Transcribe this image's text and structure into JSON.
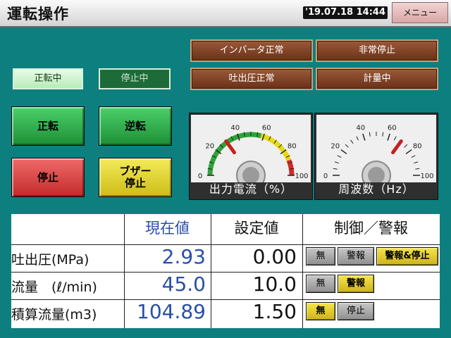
{
  "header": {
    "title": "運転操作",
    "datetime": "'19.07.18 14:44",
    "menu_label": "メニュー"
  },
  "status_lamps": {
    "inverter": "インバータ正常",
    "emergency": "非常停止",
    "discharge": "吐出圧正常",
    "metering": "計量中"
  },
  "indicators": {
    "running": "正転中",
    "stopped": "停止中"
  },
  "buttons": {
    "forward": "正転",
    "reverse": "逆転",
    "stop": "停止",
    "buzzer_line1": "ブザー",
    "buzzer_line2": "停止"
  },
  "gauges": [
    {
      "label": "出力電流（%）",
      "ticks": [
        "0",
        "20",
        "40",
        "60",
        "80",
        "100"
      ],
      "value": 30
    },
    {
      "label": "周波数（Hz）",
      "ticks": [
        "0",
        "20",
        "40",
        "60",
        "80",
        "100"
      ],
      "value": 70
    }
  ],
  "table": {
    "headers": {
      "current": "現在値",
      "setting": "設定値",
      "control": "制御／警報"
    },
    "rows": [
      {
        "label": "吐出圧(MPa)",
        "current": "2.93",
        "setting": "0.00",
        "controls": [
          {
            "label": "無",
            "active": false
          },
          {
            "label": "警報",
            "active": false
          },
          {
            "label": "警報&停止",
            "active": true
          }
        ]
      },
      {
        "label": "流量　(ℓ/min)",
        "current": "45.0",
        "setting": "10.0",
        "controls": [
          {
            "label": "無",
            "active": false
          },
          {
            "label": "警報",
            "active": true
          }
        ]
      },
      {
        "label": "積算流量(m3)",
        "current": "104.89",
        "setting": "1.50",
        "controls": [
          {
            "label": "無",
            "active": true
          },
          {
            "label": "停止",
            "active": false
          }
        ]
      }
    ]
  },
  "colors": {
    "background": "#0e7f7f",
    "current_value_text": "#2a4fa8",
    "lamp_brown": "#7a3a1e",
    "active_yellow": "#e8d42a"
  }
}
